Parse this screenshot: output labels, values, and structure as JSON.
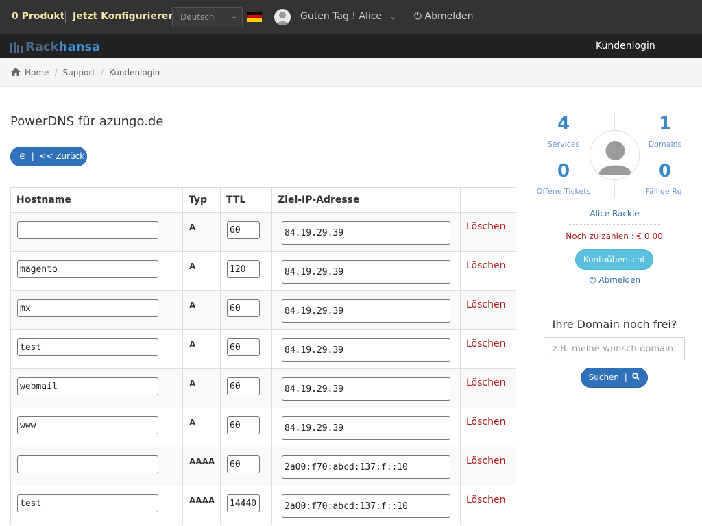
{
  "topbar": {
    "cart": "0 Produkt",
    "configure": "Jetzt Konfigurieren",
    "language": "Deutsch",
    "greeting": "Guten Tag ! Alice",
    "logout": "Abmelden"
  },
  "brand": {
    "part1": "Rack",
    "part2": "hansa",
    "nav_item": "Kundenlogin"
  },
  "breadcrumb": [
    "Home",
    "Support",
    "Kundenlogin"
  ],
  "page": {
    "title": "PowerDNS für azungo.de",
    "back_button": "<< Zurück"
  },
  "table": {
    "headers": [
      "Hostname",
      "Typ",
      "TTL",
      "Ziel-IP-Adresse",
      ""
    ],
    "delete_label": "Löschen",
    "rows": [
      {
        "host": "",
        "type": "A",
        "ttl": "60",
        "ip": "84.19.29.39"
      },
      {
        "host": "magento",
        "type": "A",
        "ttl": "120",
        "ip": "84.19.29.39"
      },
      {
        "host": "mx",
        "type": "A",
        "ttl": "60",
        "ip": "84.19.29.39"
      },
      {
        "host": "test",
        "type": "A",
        "ttl": "60",
        "ip": "84.19.29.39"
      },
      {
        "host": "webmail",
        "type": "A",
        "ttl": "60",
        "ip": "84.19.29.39"
      },
      {
        "host": "www",
        "type": "A",
        "ttl": "60",
        "ip": "84.19.29.39"
      },
      {
        "host": "",
        "type": "AAAA",
        "ttl": "60",
        "ip": "2a00:f70:abcd:137:f::10"
      },
      {
        "host": "test",
        "type": "AAAA",
        "ttl": "14440",
        "ip": "2a00:f70:abcd:137:f::10"
      }
    ]
  },
  "sidebar": {
    "services_count": "4",
    "services_label": "Services",
    "domains_count": "1",
    "domains_label": "Domains",
    "tickets_count": "0",
    "tickets_label": "Offene Tickets",
    "invoices_count": "0",
    "invoices_label": "Fällige Rg.",
    "user_name": "Alice Rackie",
    "due": "Noch zu zahlen : € 0.00",
    "account_button": "Kontoübersicht",
    "logout": "Abmelden",
    "domain_question": "Ihre Domain noch frei?",
    "domain_placeholder": "z.B. meine-wunsch-domain.de",
    "search_button": "Suchen"
  },
  "colors": {
    "topbar": "#333333",
    "brandbar": "#222222",
    "accent": "#2f72b9",
    "danger": "#b21c1c",
    "info": "#5bc0de"
  }
}
